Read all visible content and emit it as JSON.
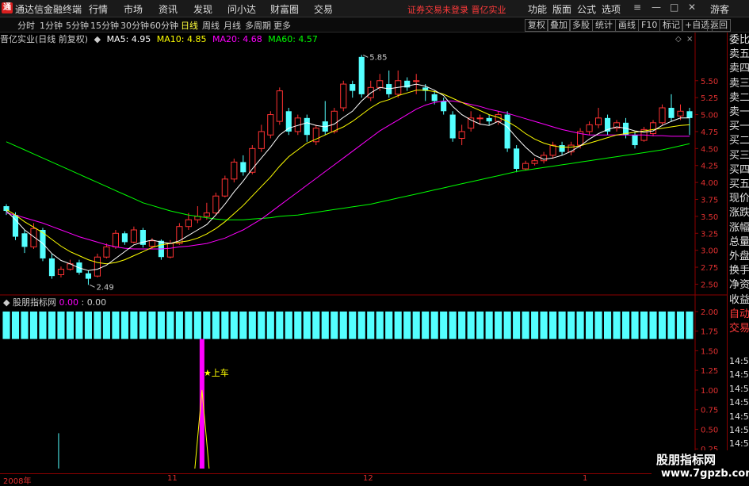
{
  "titlebar": {
    "app_name": "通达信金融终端",
    "menu": [
      "行情",
      "市场",
      "资讯",
      "发现",
      "问小达",
      "财富圈",
      "交易"
    ],
    "notice": "证券交易未登录  晋亿实业",
    "right_menu": [
      "功能",
      "版面",
      "公式",
      "选项"
    ],
    "guest": "游客"
  },
  "periods": [
    "分时",
    "1分钟",
    "5分钟",
    "15分钟",
    "30分钟",
    "60分钟",
    "日线",
    "周线",
    "月线",
    "多周期",
    "更多"
  ],
  "active_period": "日线",
  "tools": [
    "复权",
    "叠加",
    "多股",
    "统计",
    "画线",
    "F10",
    "标记",
    "+自选",
    "返回"
  ],
  "main": {
    "stock_title": "晋亿实业(日线 前复权)",
    "ma5": "MA5: 4.95",
    "ma10": "MA10: 4.85",
    "ma20": "MA20: 4.68",
    "ma60": "MA60: 4.57",
    "high_label": "5.85",
    "low_label": "2.49",
    "y_ticks": [
      "5.50",
      "5.25",
      "5.00",
      "4.75",
      "4.50",
      "4.25",
      "4.00",
      "3.75",
      "3.50",
      "3.25",
      "3.00",
      "2.75",
      "2.50"
    ]
  },
  "indicator": {
    "name": "股朋指标网",
    "v1": "0.00",
    "v2": "0.00",
    "signal_label": "★上车",
    "y_ticks": [
      "2.00",
      "1.75",
      "1.50",
      "1.25",
      "1.00",
      "0.75",
      "0.50",
      "0.25"
    ]
  },
  "x_labels": [
    "2008年",
    "11",
    "12",
    "1"
  ],
  "sidebar": {
    "items": [
      "委比",
      "卖五",
      "卖四",
      "卖三",
      "卖二",
      "卖一",
      "买一",
      "买二",
      "买三",
      "买四",
      "买五",
      "现价",
      "涨跌",
      "涨幅",
      "总量",
      "外盘",
      "换手",
      "净资",
      "收益",
      "自动",
      "交易"
    ],
    "times": [
      "14:56",
      "14:56",
      "14:56",
      "14:56",
      "14:56",
      "14:56",
      "14:56",
      "14:56",
      "14:56"
    ]
  },
  "watermark": {
    "line1": "股朋指标网",
    "line2": "www.7gpzb.com"
  },
  "colors": {
    "up": "#ff3232",
    "down": "#54ffff",
    "ma5": "#ffffff",
    "ma10": "#ffff00",
    "ma20": "#ff00ff",
    "ma60": "#00ff00",
    "indicator_bar": "#54ffff",
    "signal": "#ff00ff"
  },
  "chart_data": {
    "type": "candlestick",
    "ylim": [
      2.4,
      6.0
    ],
    "candles": [
      [
        3.65,
        3.58,
        3.68,
        3.52
      ],
      [
        3.52,
        3.2,
        3.56,
        3.15
      ],
      [
        3.25,
        3.05,
        3.3,
        2.96
      ],
      [
        3.05,
        3.32,
        3.4,
        3.02
      ],
      [
        3.3,
        2.88,
        3.33,
        2.84
      ],
      [
        2.88,
        2.62,
        2.95,
        2.58
      ],
      [
        2.64,
        2.72,
        2.76,
        2.6
      ],
      [
        2.72,
        2.8,
        2.86,
        2.7
      ],
      [
        2.82,
        2.67,
        2.86,
        2.64
      ],
      [
        2.66,
        2.58,
        2.7,
        2.49
      ],
      [
        2.62,
        2.9,
        2.95,
        2.6
      ],
      [
        2.9,
        3.05,
        3.1,
        2.88
      ],
      [
        3.05,
        3.25,
        3.3,
        3.02
      ],
      [
        3.25,
        3.12,
        3.28,
        3.08
      ],
      [
        3.12,
        3.3,
        3.35,
        3.1
      ],
      [
        3.3,
        3.08,
        3.33,
        3.04
      ],
      [
        3.06,
        3.14,
        3.18,
        3.02
      ],
      [
        3.14,
        2.9,
        3.16,
        2.86
      ],
      [
        2.9,
        3.1,
        3.15,
        2.88
      ],
      [
        3.1,
        3.35,
        3.4,
        3.08
      ],
      [
        3.35,
        3.45,
        3.55,
        3.3
      ],
      [
        3.45,
        3.5,
        3.65,
        3.4
      ],
      [
        3.5,
        3.55,
        3.7,
        3.45
      ],
      [
        3.55,
        3.8,
        3.85,
        3.52
      ],
      [
        3.8,
        4.05,
        4.1,
        3.78
      ],
      [
        4.05,
        4.3,
        4.35,
        4.0
      ],
      [
        4.3,
        4.15,
        4.4,
        4.1
      ],
      [
        4.15,
        4.5,
        4.55,
        4.12
      ],
      [
        4.5,
        4.75,
        4.85,
        4.45
      ],
      [
        4.7,
        5.0,
        5.05,
        4.65
      ],
      [
        4.9,
        5.35,
        5.4,
        4.85
      ],
      [
        5.05,
        4.75,
        5.1,
        4.7
      ],
      [
        4.75,
        4.95,
        5.0,
        4.7
      ],
      [
        4.95,
        4.7,
        5.0,
        4.6
      ],
      [
        4.6,
        4.8,
        4.85,
        4.55
      ],
      [
        4.9,
        4.75,
        5.2,
        4.7
      ],
      [
        4.75,
        5.05,
        5.1,
        4.72
      ],
      [
        5.1,
        5.45,
        5.5,
        5.05
      ],
      [
        5.45,
        5.35,
        5.5,
        5.25
      ],
      [
        5.85,
        5.3,
        5.88,
        5.25
      ],
      [
        5.25,
        5.4,
        5.5,
        5.2
      ],
      [
        5.4,
        5.5,
        5.6,
        5.35
      ],
      [
        5.45,
        5.3,
        5.65,
        5.25
      ],
      [
        5.3,
        5.5,
        5.65,
        5.25
      ],
      [
        5.5,
        5.4,
        5.55,
        5.35
      ],
      [
        5.5,
        5.5,
        5.6,
        5.3
      ],
      [
        5.4,
        5.35,
        5.45,
        5.2
      ],
      [
        5.3,
        5.2,
        5.35,
        5.15
      ],
      [
        5.2,
        5.05,
        5.25,
        5.0
      ],
      [
        5.0,
        4.65,
        5.05,
        4.6
      ],
      [
        4.65,
        4.75,
        4.85,
        4.55
      ],
      [
        4.8,
        4.95,
        5.05,
        4.75
      ],
      [
        4.95,
        4.95,
        5.0,
        4.85
      ],
      [
        4.95,
        4.9,
        5.0,
        4.85
      ],
      [
        4.9,
        5.0,
        5.05,
        4.85
      ],
      [
        5.0,
        4.5,
        5.05,
        4.45
      ],
      [
        4.5,
        4.2,
        4.55,
        4.15
      ],
      [
        4.2,
        4.28,
        4.32,
        4.18
      ],
      [
        4.28,
        4.32,
        4.36,
        4.25
      ],
      [
        4.32,
        4.4,
        4.45,
        4.28
      ],
      [
        4.4,
        4.55,
        4.6,
        4.35
      ],
      [
        4.55,
        4.45,
        4.6,
        4.4
      ],
      [
        4.45,
        4.55,
        4.6,
        4.4
      ],
      [
        4.55,
        4.75,
        4.8,
        4.5
      ],
      [
        4.75,
        4.85,
        4.9,
        4.7
      ],
      [
        4.85,
        4.95,
        5.1,
        4.8
      ],
      [
        4.95,
        4.75,
        5.0,
        4.7
      ],
      [
        4.8,
        4.88,
        4.92,
        4.75
      ],
      [
        4.88,
        4.7,
        4.95,
        4.65
      ],
      [
        4.7,
        4.55,
        4.75,
        4.5
      ],
      [
        4.62,
        4.78,
        4.82,
        4.6
      ],
      [
        4.72,
        4.88,
        4.92,
        4.68
      ],
      [
        4.88,
        5.1,
        5.15,
        4.85
      ],
      [
        5.1,
        4.95,
        5.3,
        4.9
      ],
      [
        4.98,
        5.05,
        5.15,
        4.92
      ],
      [
        5.05,
        4.95,
        5.1,
        4.7
      ]
    ],
    "ma5": [
      3.58,
      3.45,
      3.3,
      3.2,
      3.1,
      2.95,
      2.85,
      2.8,
      2.74,
      2.7,
      2.72,
      2.78,
      2.88,
      2.98,
      3.08,
      3.12,
      3.15,
      3.12,
      3.1,
      3.14,
      3.22,
      3.3,
      3.38,
      3.52,
      3.68,
      3.86,
      4.02,
      4.2,
      4.36,
      4.52,
      4.7,
      4.8,
      4.84,
      4.88,
      4.84,
      4.82,
      4.86,
      4.96,
      5.05,
      5.2,
      5.32,
      5.4,
      5.38,
      5.4,
      5.42,
      5.45,
      5.42,
      5.36,
      5.28,
      5.12,
      5.0,
      4.92,
      4.86,
      4.84,
      4.9,
      4.82,
      4.66,
      4.52,
      4.4,
      4.34,
      4.36,
      4.4,
      4.46,
      4.54,
      4.64,
      4.72,
      4.78,
      4.82,
      4.8,
      4.76,
      4.74,
      4.76,
      4.84,
      4.9,
      4.95,
      4.95
    ],
    "ma10": [
      3.6,
      3.52,
      3.42,
      3.34,
      3.26,
      3.16,
      3.06,
      2.98,
      2.92,
      2.86,
      2.82,
      2.8,
      2.82,
      2.86,
      2.92,
      2.98,
      3.04,
      3.08,
      3.1,
      3.12,
      3.14,
      3.18,
      3.24,
      3.32,
      3.42,
      3.54,
      3.66,
      3.8,
      3.94,
      4.08,
      4.24,
      4.38,
      4.48,
      4.58,
      4.64,
      4.7,
      4.76,
      4.82,
      4.9,
      5.0,
      5.1,
      5.18,
      5.22,
      5.28,
      5.32,
      5.36,
      5.36,
      5.34,
      5.3,
      5.24,
      5.18,
      5.12,
      5.06,
      5.0,
      4.96,
      4.9,
      4.82,
      4.72,
      4.64,
      4.58,
      4.54,
      4.52,
      4.52,
      4.54,
      4.58,
      4.62,
      4.66,
      4.7,
      4.72,
      4.74,
      4.76,
      4.78,
      4.8,
      4.82,
      4.84,
      4.85
    ],
    "ma20": [
      3.55,
      3.52,
      3.48,
      3.44,
      3.4,
      3.35,
      3.3,
      3.25,
      3.2,
      3.16,
      3.12,
      3.08,
      3.05,
      3.03,
      3.02,
      3.02,
      3.02,
      3.02,
      3.03,
      3.05,
      3.06,
      3.08,
      3.1,
      3.14,
      3.18,
      3.24,
      3.3,
      3.38,
      3.46,
      3.56,
      3.66,
      3.76,
      3.86,
      3.96,
      4.06,
      4.16,
      4.26,
      4.36,
      4.46,
      4.56,
      4.66,
      4.76,
      4.84,
      4.92,
      5.0,
      5.08,
      5.14,
      5.18,
      5.2,
      5.2,
      5.18,
      5.15,
      5.12,
      5.08,
      5.05,
      5.02,
      4.98,
      4.94,
      4.9,
      4.86,
      4.82,
      4.78,
      4.75,
      4.72,
      4.7,
      4.7,
      4.7,
      4.7,
      4.7,
      4.7,
      4.7,
      4.69,
      4.69,
      4.68,
      4.68,
      4.68
    ],
    "ma60": [
      4.6,
      4.54,
      4.48,
      4.42,
      4.36,
      4.3,
      4.24,
      4.18,
      4.12,
      4.06,
      4.0,
      3.94,
      3.88,
      3.82,
      3.76,
      3.7,
      3.66,
      3.62,
      3.58,
      3.55,
      3.52,
      3.5,
      3.48,
      3.46,
      3.45,
      3.45,
      3.45,
      3.46,
      3.47,
      3.48,
      3.5,
      3.51,
      3.52,
      3.54,
      3.56,
      3.58,
      3.6,
      3.62,
      3.64,
      3.66,
      3.68,
      3.71,
      3.74,
      3.77,
      3.8,
      3.83,
      3.86,
      3.89,
      3.92,
      3.95,
      3.98,
      4.01,
      4.04,
      4.07,
      4.1,
      4.13,
      4.16,
      4.18,
      4.2,
      4.22,
      4.24,
      4.26,
      4.28,
      4.3,
      4.32,
      4.34,
      4.36,
      4.38,
      4.4,
      4.42,
      4.44,
      4.46,
      4.48,
      4.51,
      4.54,
      4.57
    ],
    "indicator": {
      "bar_value": 2.0,
      "ylim": [
        0,
        2.1
      ],
      "signal_index": 22,
      "signal_value": 1.0,
      "early_spike_index": 6,
      "early_spike_value": 0.45
    }
  }
}
